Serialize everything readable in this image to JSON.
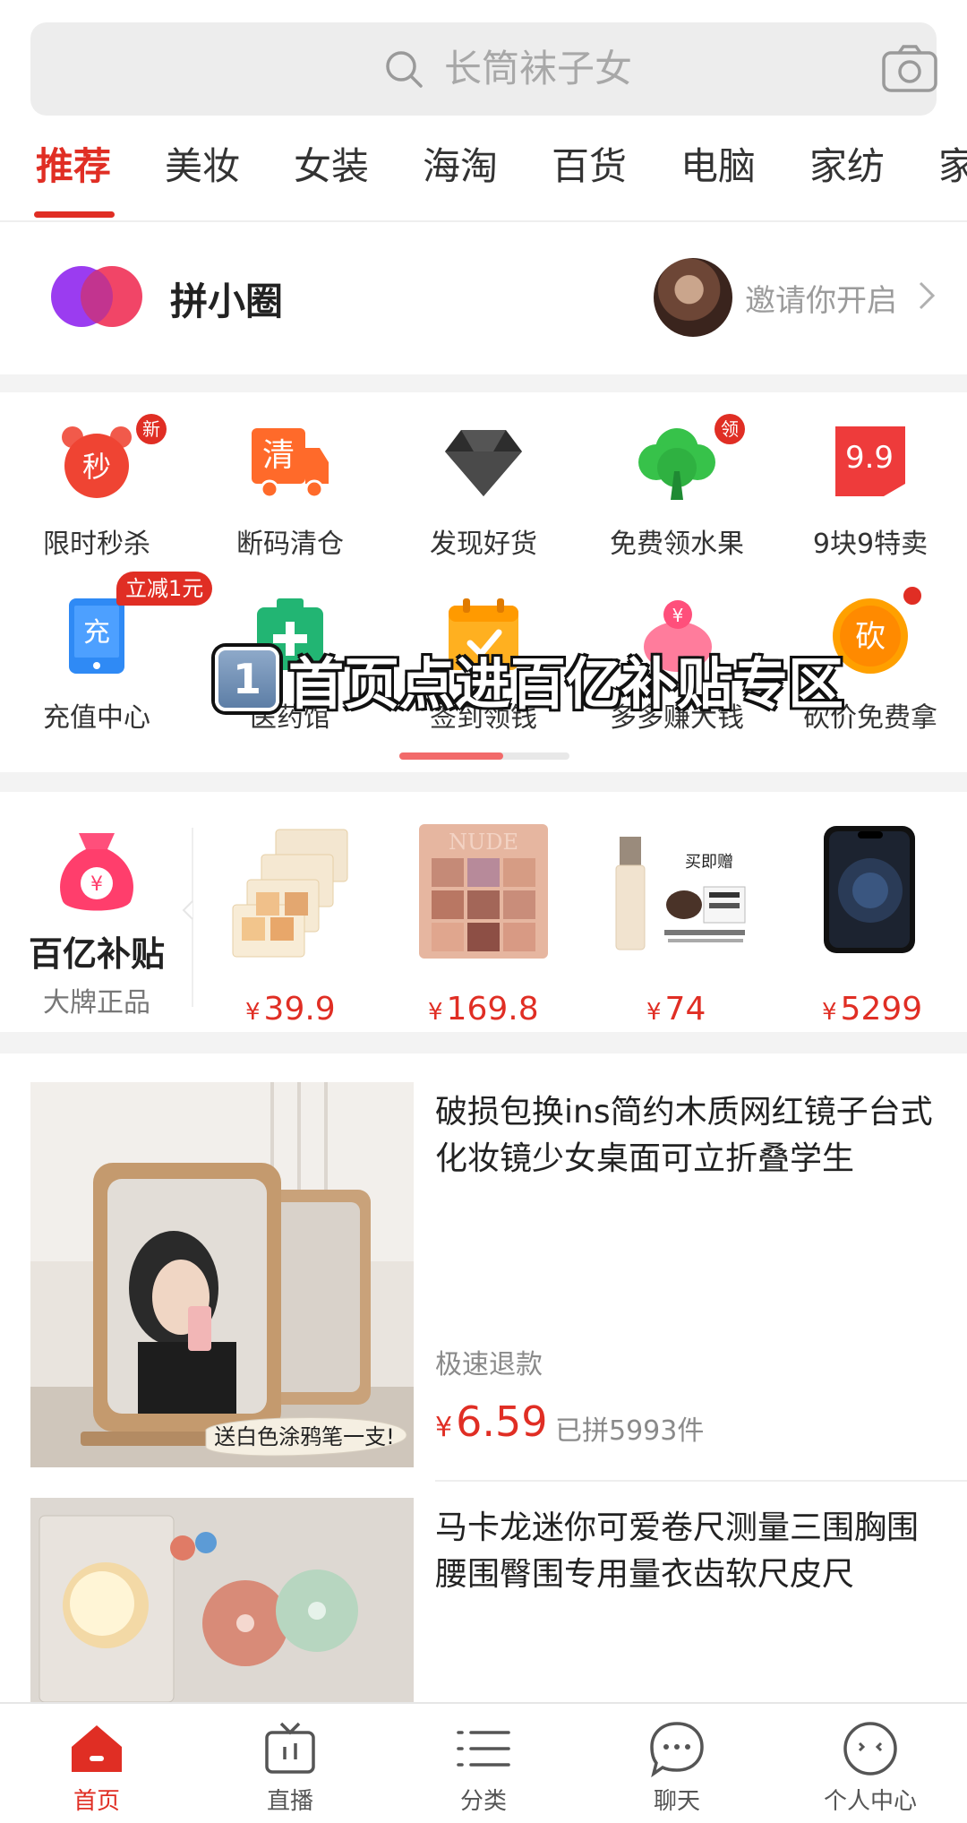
{
  "search": {
    "placeholder": "长筒袜子女"
  },
  "tabs": [
    "推荐",
    "美妆",
    "女装",
    "海淘",
    "百货",
    "电脑",
    "家纺",
    "家"
  ],
  "circle": {
    "title": "拼小圈",
    "invite": "邀请你开启"
  },
  "grid": [
    {
      "label": "限时秒杀",
      "icon": "alarm-clock-icon",
      "badge": "新",
      "icon_text": "秒"
    },
    {
      "label": "断码清仓",
      "icon": "truck-icon",
      "icon_text": "清"
    },
    {
      "label": "发现好货",
      "icon": "diamond-icon"
    },
    {
      "label": "免费领水果",
      "icon": "tree-icon",
      "badge": "领"
    },
    {
      "label": "9块9特卖",
      "icon": "tag-icon",
      "icon_text": "9.9"
    },
    {
      "label": "充值中心",
      "icon": "phone-icon",
      "badge": "立减1元",
      "icon_text": "充"
    },
    {
      "label": "医药馆",
      "icon": "medicine-box-icon"
    },
    {
      "label": "签到领钱",
      "icon": "calendar-icon"
    },
    {
      "label": "多多赚大钱",
      "icon": "piggy-bank-icon",
      "icon_text": "¥"
    },
    {
      "label": "砍价免费拿",
      "icon": "bargain-icon",
      "icon_text": "砍"
    }
  ],
  "overlay": {
    "number": "1",
    "text": "首页点进百亿补贴专区"
  },
  "subsidy": {
    "title": "百亿补贴",
    "subtitle": "大牌正品",
    "bag_text": "¥",
    "products": [
      {
        "name": "eyeshadow-set",
        "price": "39.9"
      },
      {
        "name": "nude-palette",
        "price": "169.8",
        "label": "NUDE"
      },
      {
        "name": "foundation",
        "price": "74",
        "label": "买即赠"
      },
      {
        "name": "iphone",
        "price": "5299"
      }
    ],
    "currency": "¥"
  },
  "feed": [
    {
      "title": "破损包换ins简约木质网红镜子台式化妆镜少女桌面可立折叠学生",
      "tag": "极速退款",
      "price": "6.59",
      "sold": "已拼5993件",
      "sticker": "送白色涂鸦笔一支!"
    },
    {
      "title": "马卡龙迷你可爱卷尺测量三围胸围腰围臀围专用量衣齿软尺皮尺"
    }
  ],
  "nav": [
    {
      "label": "首页",
      "icon": "home-icon",
      "active": true
    },
    {
      "label": "直播",
      "icon": "tv-icon"
    },
    {
      "label": "分类",
      "icon": "list-icon"
    },
    {
      "label": "聊天",
      "icon": "chat-icon"
    },
    {
      "label": "个人中心",
      "icon": "profile-icon"
    }
  ],
  "colors": {
    "accent": "#e02e24",
    "gray_text": "#8a8a8a",
    "bg_gap": "#f3f3f3"
  }
}
